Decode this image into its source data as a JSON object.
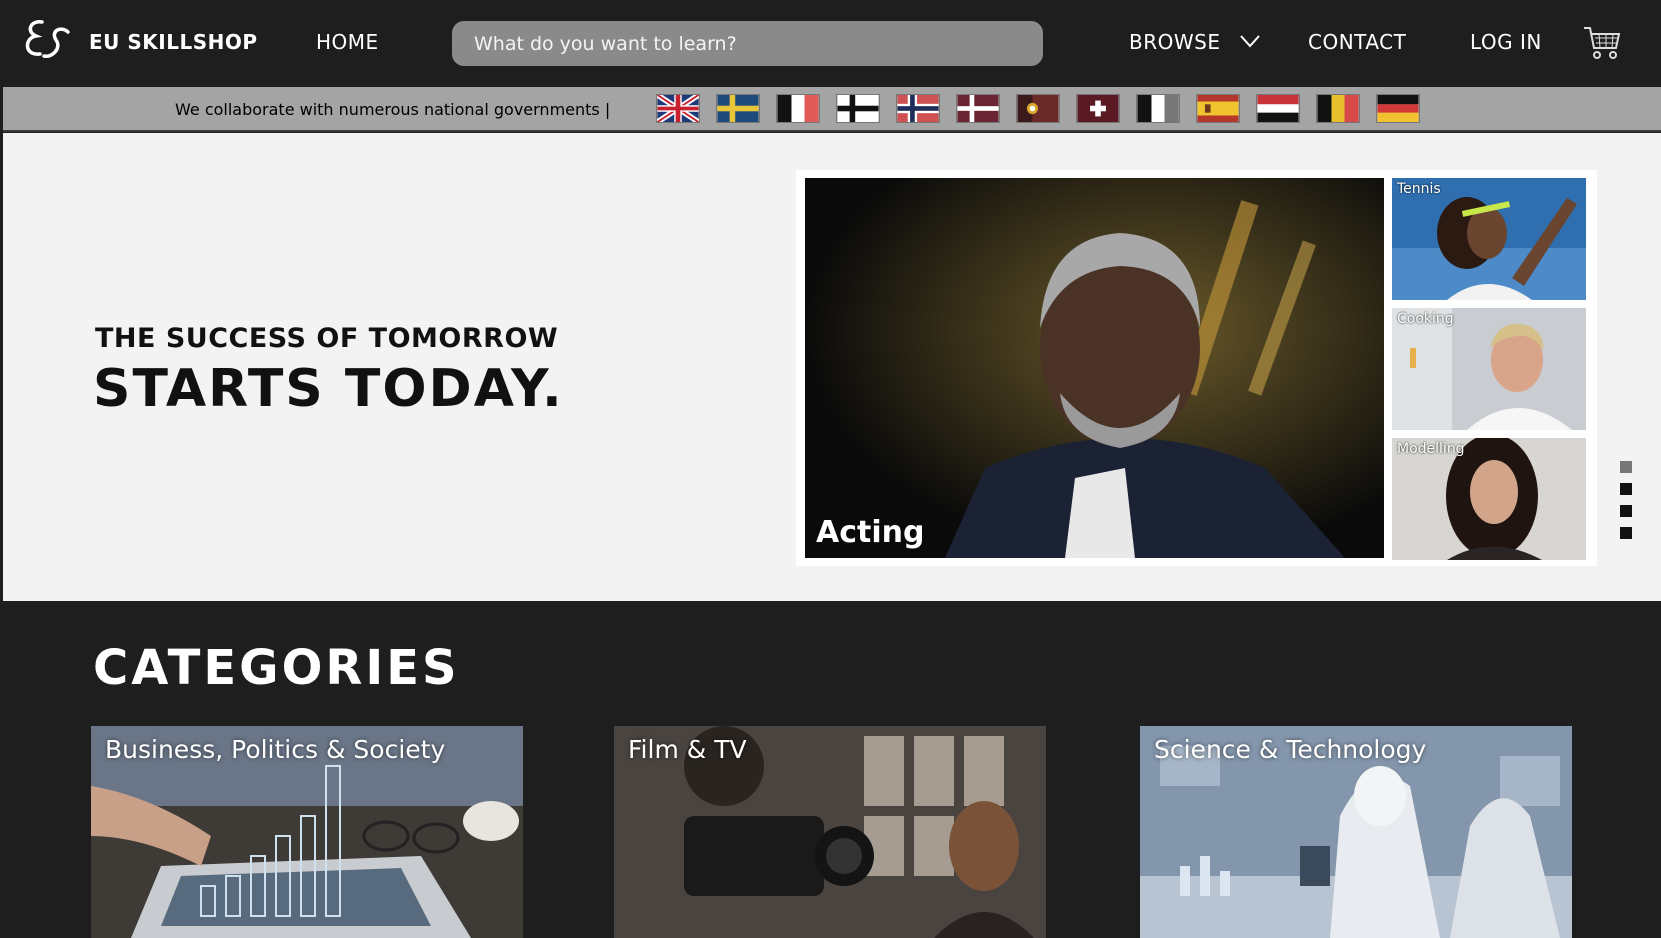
{
  "header": {
    "brand": "EU SKILLSHOP",
    "logo_icon": "script-es-logo-icon",
    "nav": {
      "home": "HOME",
      "browse": "BROWSE",
      "contact": "CONTACT",
      "login": "LOG IN"
    },
    "search_placeholder": "What do you want to learn?",
    "cart_icon": "shopping-cart-icon"
  },
  "flag_strip": {
    "text": "We collaborate with numerous national governments |",
    "flags": [
      "united-kingdom",
      "sweden",
      "france",
      "finland",
      "norway",
      "denmark",
      "portugal",
      "switzerland",
      "italy",
      "spain",
      "netherlands",
      "belgium",
      "germany"
    ]
  },
  "hero": {
    "tagline_small": "THE SUCCESS OF TOMORROW",
    "tagline_big": "STARTS TODAY.",
    "featured": {
      "label": "Acting"
    },
    "side_tiles": [
      {
        "label": "Tennis"
      },
      {
        "label": "Cooking"
      },
      {
        "label": "Modelling"
      }
    ],
    "slides": 4,
    "active_slide": 1
  },
  "categories": {
    "title": "CATEGORIES",
    "items": [
      {
        "label": "Business, Politics & Society"
      },
      {
        "label": "Film & TV"
      },
      {
        "label": "Science & Technology"
      }
    ]
  },
  "colors": {
    "header_bg": "#1e1e1e",
    "search_bg": "#8a8a8a",
    "flag_strip_bg": "#a4a4a4",
    "hero_bg": "#f3f3f3",
    "accent_line": "#3b6fd6"
  }
}
